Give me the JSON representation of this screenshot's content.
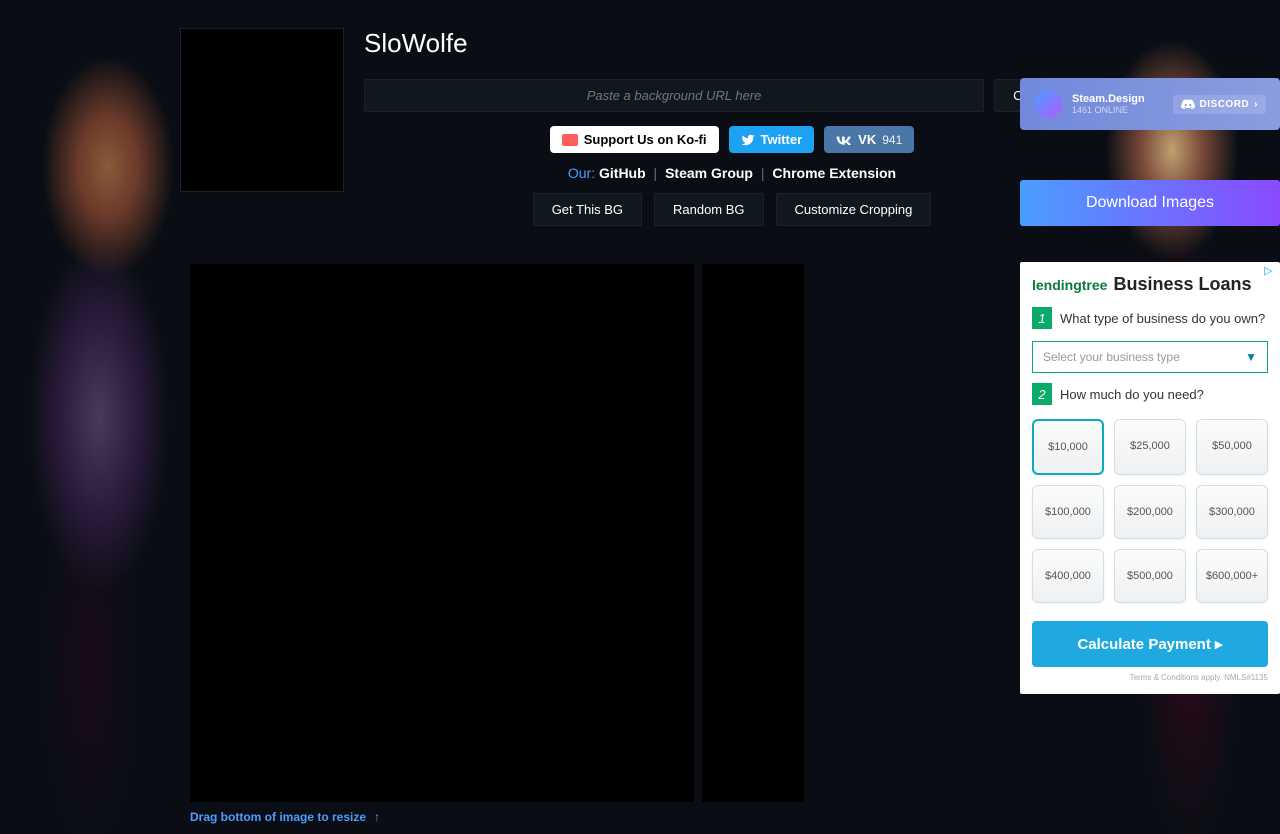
{
  "title": "SloWolfe",
  "url_input": {
    "placeholder": "Paste a background URL here"
  },
  "buttons": {
    "change_bg": "Change BG",
    "kofi": "Support Us on Ko-fi",
    "twitter": "Twitter",
    "vk": "VK",
    "vk_count": "941",
    "get_bg": "Get This BG",
    "random_bg": "Random BG",
    "customize": "Customize Cropping",
    "download": "Download Images"
  },
  "links": {
    "our": "Our:",
    "github": "GitHub",
    "steam_group": "Steam Group",
    "chrome_ext": "Chrome Extension"
  },
  "discord": {
    "title": "Steam.Design",
    "sub": "1461 ONLINE",
    "badge": "DISCORD"
  },
  "ad": {
    "logo": "lendingtree",
    "headline": "Business Loans",
    "q1_num": "1",
    "q1": "What type of business do you own?",
    "select_placeholder": "Select your business type",
    "q2_num": "2",
    "q2": "How much do you need?",
    "amounts": [
      "$10,000",
      "$25,000",
      "$50,000",
      "$100,000",
      "$200,000",
      "$300,000",
      "$400,000",
      "$500,000",
      "$600,000+"
    ],
    "cta": "Calculate Payment",
    "fine": "Terms & Conditions apply. NMLS#1135"
  },
  "resize_hint": "Drag bottom of image to resize"
}
